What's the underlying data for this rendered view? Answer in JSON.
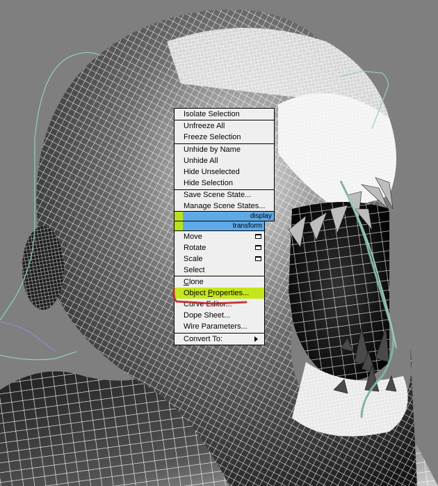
{
  "scene": {
    "background_color": "#7f7f7f",
    "wire_color": "#ffffff",
    "spline_color": "#8fd0c0",
    "spline2_color": "#8a8fd0"
  },
  "menu": {
    "upper_section": [
      {
        "label": "Isolate Selection"
      },
      {
        "label": "Unfreeze All"
      },
      {
        "label": "Freeze Selection"
      },
      {
        "label": "Unhide by Name"
      },
      {
        "label": "Unhide All"
      },
      {
        "label": "Hide Unselected"
      },
      {
        "label": "Hide Selection"
      },
      {
        "label": "Save Scene State..."
      },
      {
        "label": "Manage Scene States..."
      }
    ],
    "display_bar_label": "display",
    "transform_bar_label": "transform",
    "lower_section": [
      {
        "label": "Move",
        "has_options": true
      },
      {
        "label": "Rotate",
        "has_options": true
      },
      {
        "label": "Scale",
        "has_options": true
      },
      {
        "label": "Select"
      },
      {
        "label_pre": "",
        "mnemonic": "C",
        "label_post": "lone"
      },
      {
        "label_pre": "Object ",
        "mnemonic": "P",
        "label_post": "roperties...",
        "highlighted": true
      },
      {
        "label": "Curve Editor..."
      },
      {
        "label": "Dope Sheet..."
      },
      {
        "label": "Wire Parameters..."
      },
      {
        "label": "Convert To:",
        "has_submenu": true
      }
    ],
    "highlight_color": "#c6e61b",
    "bar_color": "#5fa9e6",
    "annotation_color": "#c0262a"
  }
}
